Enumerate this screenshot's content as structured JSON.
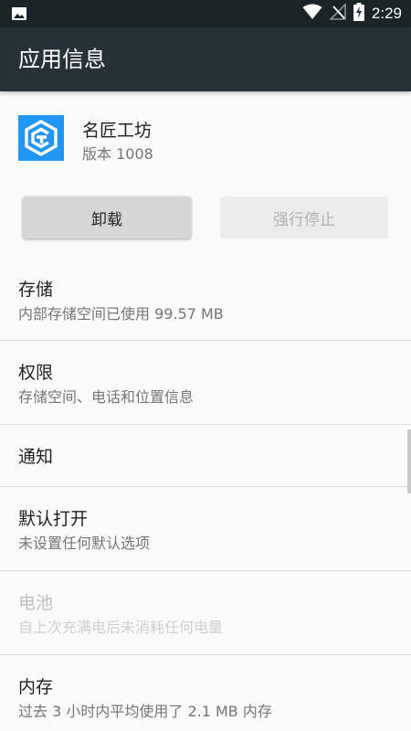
{
  "status_bar": {
    "time": "2:29",
    "icons": [
      "image-notification-icon",
      "wifi-icon",
      "no-signal-icon",
      "battery-charging-icon"
    ]
  },
  "app_bar": {
    "title": "应用信息"
  },
  "app": {
    "name": "名匠工坊",
    "version": "版本 1008",
    "icon_color": "#2196f3"
  },
  "buttons": {
    "uninstall": "卸载",
    "force_stop": "强行停止"
  },
  "settings": [
    {
      "title": "存储",
      "subtitle": "内部存储空间已使用 99.57 MB",
      "enabled": true
    },
    {
      "title": "权限",
      "subtitle": "存储空间、电话和位置信息",
      "enabled": true
    },
    {
      "title": "通知",
      "subtitle": "",
      "enabled": true
    },
    {
      "title": "默认打开",
      "subtitle": "未设置任何默认选项",
      "enabled": true
    },
    {
      "title": "电池",
      "subtitle": "自上次充满电后未消耗任何电量",
      "enabled": false
    },
    {
      "title": "内存",
      "subtitle": "过去 3 小时内平均使用了 2.1 MB 内存",
      "enabled": true
    }
  ],
  "colors": {
    "app_bar": "#263238",
    "status_bar": "#1a2326",
    "background": "#fafafa"
  }
}
